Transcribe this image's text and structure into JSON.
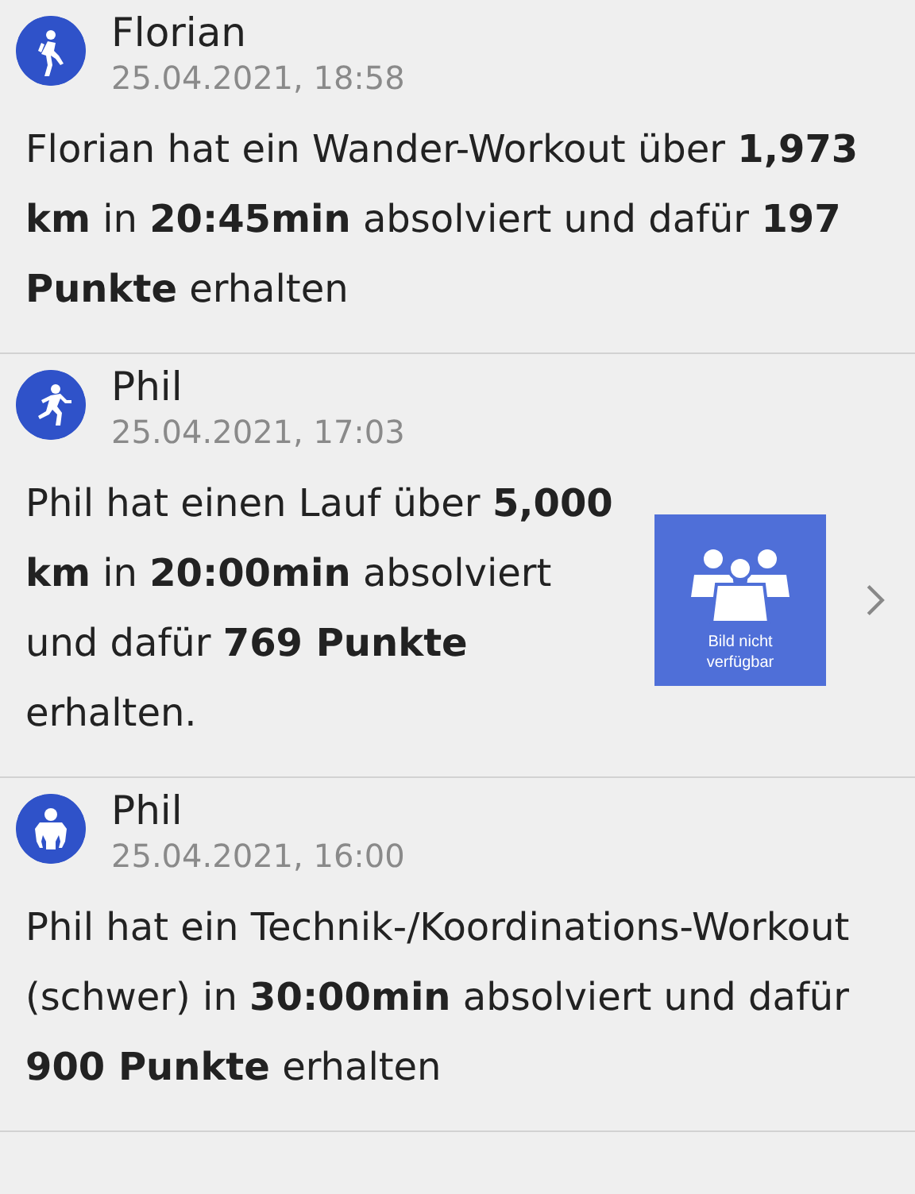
{
  "entries": [
    {
      "kind": "hike",
      "name": "Florian",
      "time": "25.04.2021, 18:58",
      "text": "Florian hat ein Wander-Workout über **1,973 km** in **20:45min** absolviert und dafür **197 Punkte** erhalten"
    },
    {
      "kind": "run",
      "name": "Phil",
      "time": "25.04.2021, 17:03",
      "text": "Phil hat einen Lauf über **5,000 km** in **20:00min** absolviert und dafür **769 Punkte** erhalten.",
      "thumbnail": {
        "caption": "Bild nicht verfügbar"
      }
    },
    {
      "kind": "figure",
      "name": "Phil",
      "time": "25.04.2021, 16:00",
      "text": "Phil hat ein Technik-/Koordinations-Workout (schwer) in **30:00min** absolviert und dafür **900 Punkte** erhalten"
    }
  ]
}
